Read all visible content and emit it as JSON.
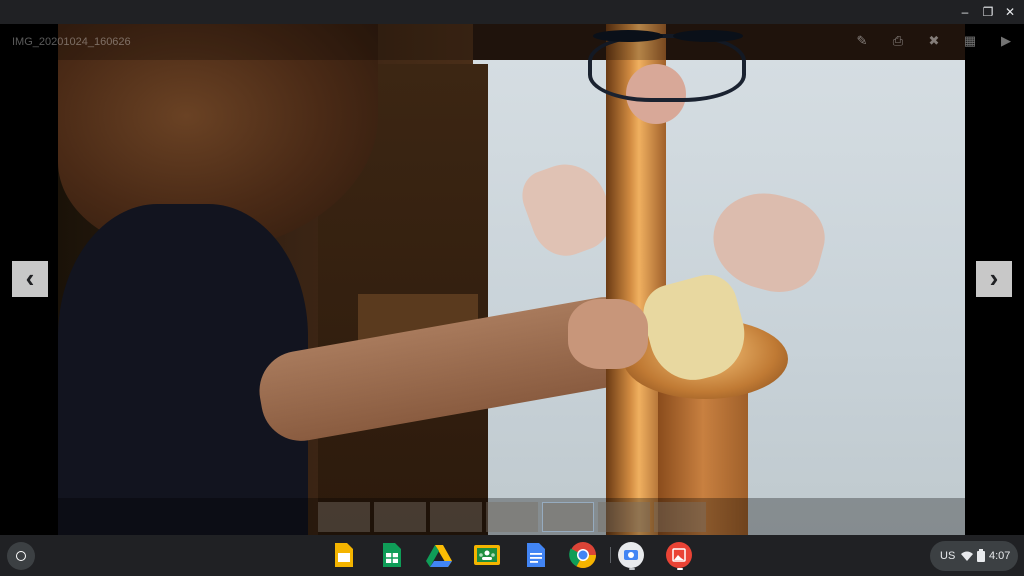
{
  "window": {
    "controls": {
      "minimize": "–",
      "restore": "❐",
      "close": "✕"
    }
  },
  "viewer": {
    "image_title": "IMG_20201024_160626",
    "toolbar_icons": [
      "pencil-icon",
      "print-icon",
      "trash-icon",
      "grid-icon",
      "slideshow-icon"
    ],
    "toolbar_glyphs": {
      "edit": "✎",
      "print": "⎙",
      "delete": "✖",
      "gallery": "▦",
      "slideshow": "▶"
    },
    "nav": {
      "prev": "‹",
      "next": "›"
    }
  },
  "shelf": {
    "apps": [
      "Google Slides",
      "Google Sheets",
      "Google Drive",
      "Google Classroom",
      "Google Docs",
      "Google Chrome",
      "Camera",
      "Gallery"
    ],
    "tray": {
      "keyboard_layout": "US",
      "time": "4:07"
    }
  },
  "colors": {
    "shelf_bg": "#202124",
    "slides": "#f4b400",
    "sheets": "#0f9d58",
    "docs": "#4285f4",
    "classroom": "#1e8e3e",
    "gallery": "#ea4335"
  }
}
